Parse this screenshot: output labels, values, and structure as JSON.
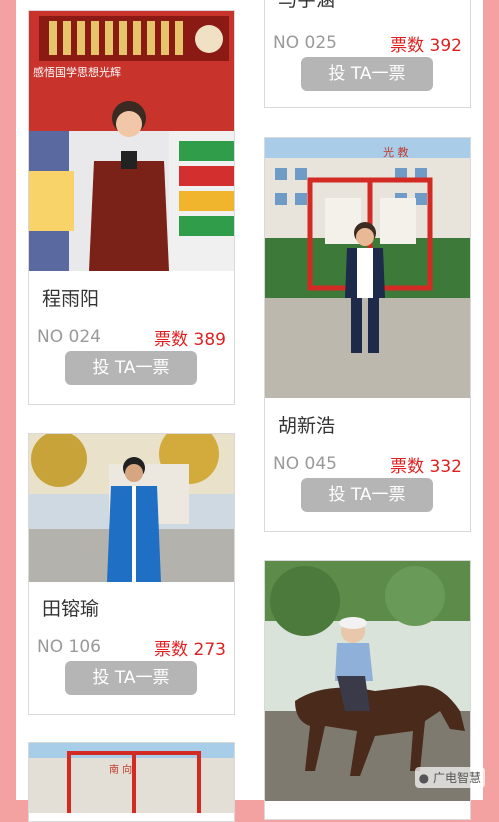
{
  "cards": [
    {
      "name": "",
      "no": "NO 025",
      "votes": "票数 392",
      "btn": "投 TA一票"
    },
    {
      "name": "程雨阳",
      "no": "NO 024",
      "votes": "票数 389",
      "btn": "投 TA一票"
    },
    {
      "name": "胡新浩",
      "no": "NO 045",
      "votes": "票数 332",
      "btn": "投 TA一票"
    },
    {
      "name": "田镕瑜",
      "no": "NO 106",
      "votes": "票数 273",
      "btn": "投 TA一票"
    }
  ],
  "partial_top_name": "马宇涵",
  "photo_texts": {
    "p1_banner": "感悟国学思想光辉",
    "p2_sign": "光 教",
    "p3_top": "南 向"
  },
  "watermark": "广电智慧",
  "colors": {
    "accent": "#e02020",
    "button": "#b5b5b5",
    "frame": "#f3a1a1"
  }
}
